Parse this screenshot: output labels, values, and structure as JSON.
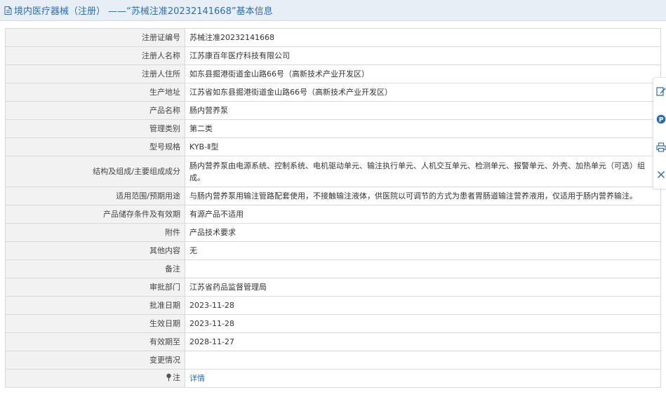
{
  "header": {
    "title": "境内医疗器械（注册） ——“苏械注准20232141668”基本信息",
    "icon": "document-icon"
  },
  "rows": [
    {
      "label": "注册证编号",
      "value": "苏械注准20232141668"
    },
    {
      "label": "注册人名称",
      "value": "江苏康百年医疗科技有限公司"
    },
    {
      "label": "注册人住所",
      "value": "如东县掘港街道金山路66号（高新技术产业开发区）"
    },
    {
      "label": "生产地址",
      "value": "江苏省如东县掘港街道金山路66号（高新技术产业开发区）"
    },
    {
      "label": "产品名称",
      "value": "肠内营养泵"
    },
    {
      "label": "管理类别",
      "value": "第二类"
    },
    {
      "label": "型号规格",
      "value": "KYB-Ⅱ型"
    },
    {
      "label": "结构及组成/主要组成成分",
      "value": "肠内营养泵由电源系统、控制系统、电机驱动单元、输注执行单元、人机交互单元、检测单元、报警单元、外壳、加热单元（可选）组成。"
    },
    {
      "label": "适用范围/预期用途",
      "value": "与肠内营养泵用输注管路配套使用，不接触输注液体，供医院以可调节的方式为患者胃肠道输注营养液用，仅适用于肠内营养输注。"
    },
    {
      "label": "产品储存条件及有效期",
      "value": "有源产品不适用"
    },
    {
      "label": "附件",
      "value": "产品技术要求"
    },
    {
      "label": "其他内容",
      "value": "无"
    },
    {
      "label": "备注",
      "value": ""
    },
    {
      "label": "审批部门",
      "value": "江苏省药品监督管理局"
    },
    {
      "label": "批准日期",
      "value": "2023-11-28"
    },
    {
      "label": "生效日期",
      "value": "2023-11-28"
    },
    {
      "label": "有效期至",
      "value": "2028-11-27"
    },
    {
      "label": "变更情况",
      "value": ""
    }
  ],
  "note_row": {
    "label": "注",
    "icon": "pin-icon",
    "link": "详情"
  },
  "side_tools": [
    "edit-icon",
    "help-icon",
    "print-icon",
    "close-icon"
  ]
}
